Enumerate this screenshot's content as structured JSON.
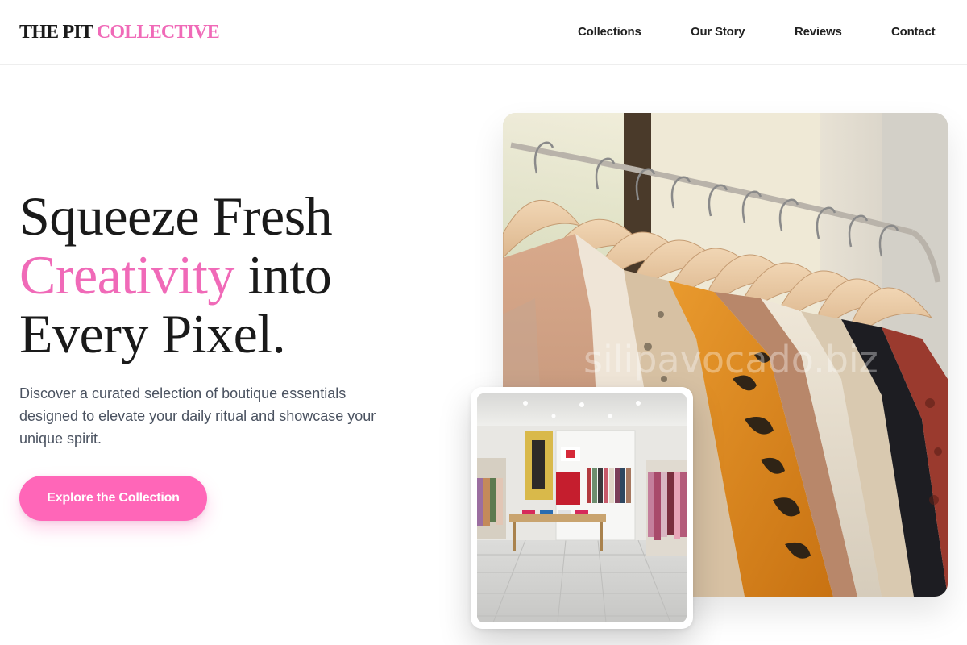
{
  "brand": {
    "name_part1": "THE PIT",
    "name_part2": "COLLECTIVE",
    "accent_color": "#f06ab8"
  },
  "nav": {
    "items": [
      {
        "label": "Collections"
      },
      {
        "label": "Our Story"
      },
      {
        "label": "Reviews"
      },
      {
        "label": "Contact"
      }
    ]
  },
  "hero": {
    "title_line1": "Squeeze Fresh",
    "title_highlight": "Creativity",
    "title_line2_rest": "into",
    "title_line3": "Every Pixel.",
    "description": "Discover a curated selection of boutique essentials designed to elevate your daily ritual and showcase your unique spirit.",
    "cta_label": "Explore the Collection",
    "cta_color": "#ff66b8"
  },
  "images": {
    "main": {
      "watermark": "silipavocado.biz",
      "subject": "clothing-rack-photo"
    },
    "secondary": {
      "subject": "boutique-store-interior-photo"
    }
  }
}
